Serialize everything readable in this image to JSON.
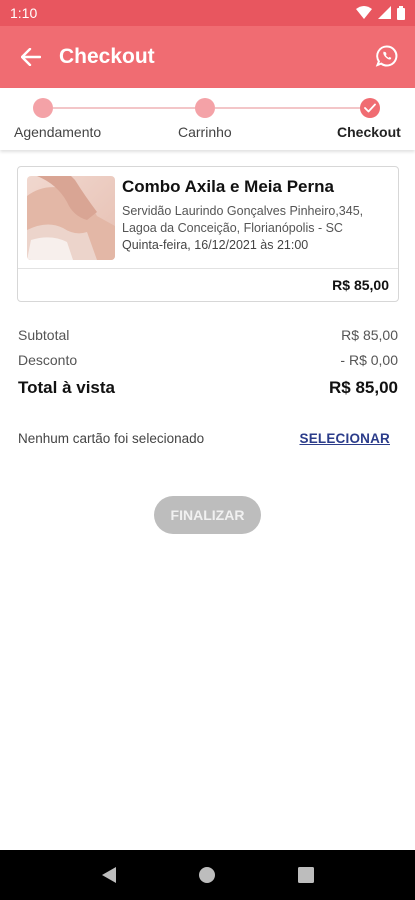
{
  "status_bar": {
    "time": "1:10"
  },
  "app_bar": {
    "title": "Checkout"
  },
  "stepper": {
    "steps": [
      {
        "label": "Agendamento"
      },
      {
        "label": "Carrinho"
      },
      {
        "label": "Checkout"
      }
    ]
  },
  "order_item": {
    "title": "Combo Axila e Meia Perna",
    "address_line1": "Servidão Laurindo Gonçalves Pinheiro,345,",
    "address_line2": "Lagoa da Conceição, Florianópolis - SC",
    "datetime": "Quinta-feira, 16/12/2021 às 21:00",
    "price": "R$ 85,00"
  },
  "summary": {
    "subtotal_label": "Subtotal",
    "subtotal_value": "R$ 85,00",
    "discount_label": "Desconto",
    "discount_value": "- R$ 0,00",
    "total_label": "Total à vista",
    "total_value": "R$ 85,00"
  },
  "payment": {
    "no_card_text": "Nenhum cartão foi selecionado",
    "select_label": "SELECIONAR"
  },
  "finalize_label": "FINALIZAR",
  "colors": {
    "primary": "#f06c72",
    "status": "#e8565f",
    "step_pending": "#f4a2a7",
    "link": "#2b3c8a",
    "disabled": "#bdbdbd"
  }
}
